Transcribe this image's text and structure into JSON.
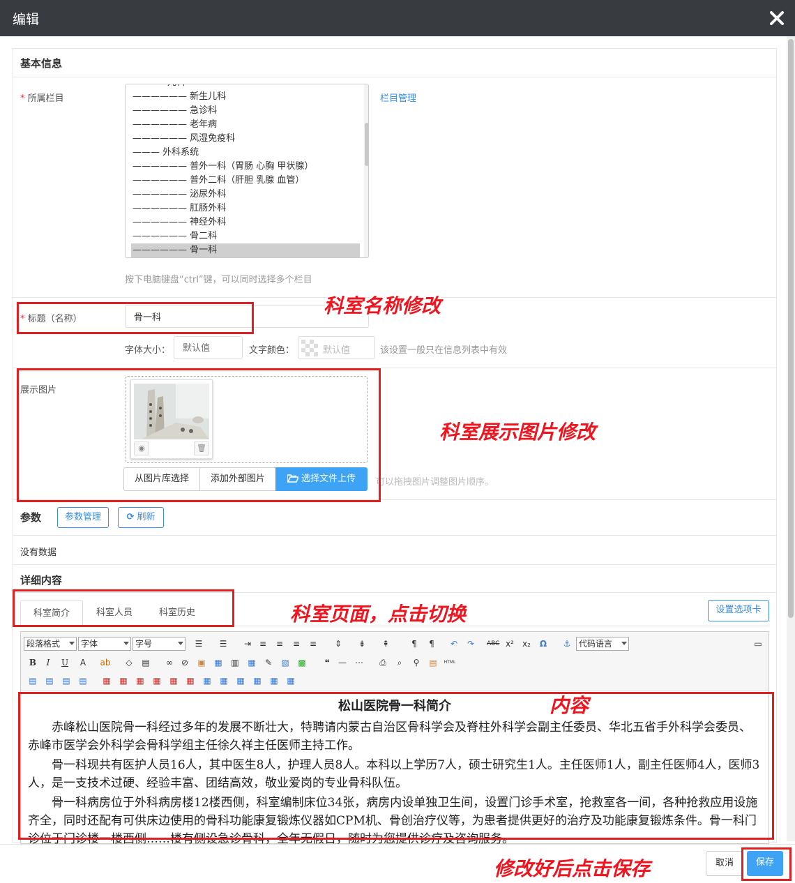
{
  "window": {
    "title": "编辑"
  },
  "basic": {
    "heading": "基本信息",
    "column_label": "所属栏目",
    "required_mark": "*",
    "column_manage_link": "栏目管理",
    "column_options": [
      "—————— 新生儿科",
      "—————— 急诊科",
      "—————— 老年病",
      "—————— 风湿免疫科",
      "——— 外科系统",
      "—————— 普外一科（胃肠 心胸 甲状腺）",
      "—————— 普外二科（肝胆 乳腺 血管）",
      "—————— 泌尿外科",
      "—————— 肛肠外科",
      "—————— 神经外科",
      "—————— 骨二科",
      "—————— 骨一科"
    ],
    "column_top_partial": "儿科",
    "column_selected": "—————— 骨一科",
    "column_hint": "按下电脑键盘“ctrl”键，可以同时选择多个栏目",
    "title_label": "标题（名称）",
    "title_value": "骨一科",
    "font_size_label": "字体大小：",
    "font_size_placeholder": "默认值",
    "font_color_label": "文字颜色：",
    "font_color_placeholder": "默认值",
    "style_hint": "该设置一般只在信息列表中有效",
    "image_label": "展示图片",
    "btn_from_library": "从图片库选择",
    "btn_add_external": "添加外部图片",
    "btn_upload": "选择文件上传",
    "image_hint": "可以拖拽图片调整图片顺序。"
  },
  "params": {
    "heading": "参数",
    "manage_button": "参数管理",
    "refresh_button": "刷新",
    "empty_text": "没有数据"
  },
  "detail": {
    "heading": "详细内容",
    "tabs": [
      "科室简介",
      "科室人员",
      "科室历史"
    ],
    "active_tab": "科室简介",
    "tab_settings_button": "设置选项卡",
    "toolbar": {
      "paragraph_format": "段落格式",
      "font_family": "字体",
      "font_size": "字号",
      "code_language": "代码语言"
    },
    "content_title": "松山医院骨一科简介",
    "paragraphs": [
      "赤峰松山医院骨一科经过多年的发展不断壮大，特聘请内蒙古自治区骨科学会及脊柱外科学会副主任委员、华北五省手外科学会委员、赤峰市医学会外科学会骨科学组主任徐久祥主任医师主持工作。",
      "骨一科现共有医护人员16人，其中医生8人，护理人员8人。本科以上学历7人，硕士研究生1人。主任医师1人，副主任医师4人，医师3人，是一支技术过硬、经验丰富、团结高效，敬业爱岗的专业骨科队伍。",
      "骨一科病房位于外科病房楼12楼西侧，科室编制床位34张，病房内设单独卫生间，设置门诊手术室，抢救室各一间，各种抢救应用设施齐全，同时还配有可供床边使用的骨科功能康复锻炼仪器如CPM机、骨创治疗仪等，为患者提供更好的治疗及功能康复锻炼条件。骨一科门诊位于门诊楼一楼西侧……楼有侧设急诊骨科，全年无假日，随时为您提供诊疗及咨询服务。"
    ]
  },
  "footer": {
    "cancel_button": "取消",
    "save_button": "保存"
  },
  "annotations": {
    "title_note": "科室名称修改",
    "image_note": "科室展示图片修改",
    "tabs_note": "科室页面，点击切换",
    "content_note": "内容",
    "save_note": "修改好后点击保存"
  },
  "colors": {
    "titlebar": "#383b40",
    "accent": "#3a8ee6",
    "primary_button": "#3ea2f5",
    "annotation_red": "#e02020"
  }
}
